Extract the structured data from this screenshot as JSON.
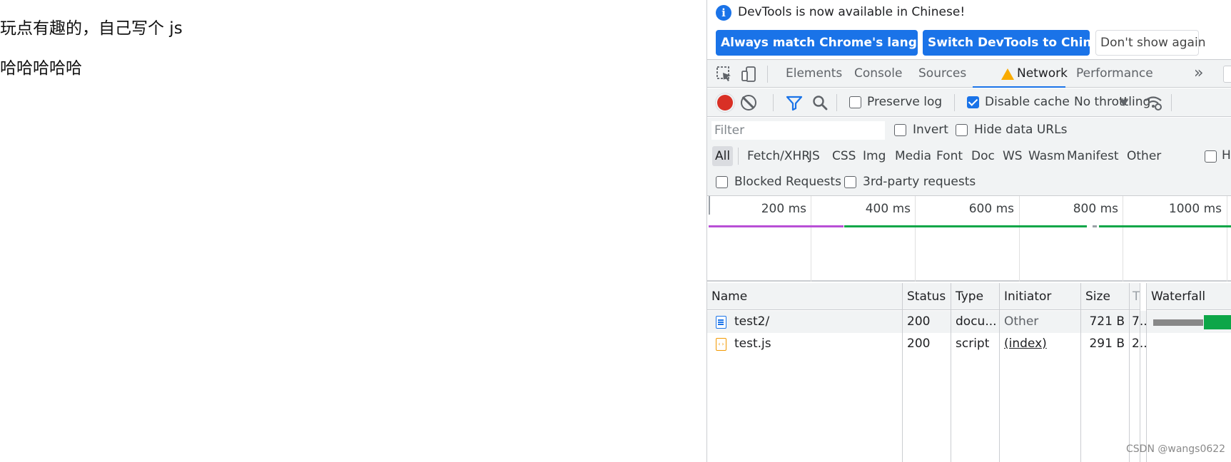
{
  "page": {
    "line1": "玩点有趣的，自己写个 js",
    "line2": "哈哈哈哈哈"
  },
  "infobar": {
    "message": "DevTools is now available in Chinese!",
    "buttons": {
      "match": "Always match Chrome's language",
      "switch": "Switch DevTools to Chinese",
      "dismiss": "Don't show again"
    }
  },
  "tabs": [
    {
      "label": "Elements"
    },
    {
      "label": "Console"
    },
    {
      "label": "Sources"
    },
    {
      "label": "Network",
      "active": true,
      "warning": true
    },
    {
      "label": "Performance"
    }
  ],
  "network_toolbar": {
    "preserve_log": {
      "label": "Preserve log",
      "checked": false
    },
    "disable_cache": {
      "label": "Disable cache",
      "checked": true
    },
    "throttling": "No throttling"
  },
  "filter": {
    "placeholder": "Filter",
    "invert": {
      "label": "Invert",
      "checked": false
    },
    "hide_data_urls": {
      "label": "Hide data URLs",
      "checked": false
    }
  },
  "type_filters": [
    "All",
    "Fetch/XHR",
    "JS",
    "CSS",
    "Img",
    "Media",
    "Font",
    "Doc",
    "WS",
    "Wasm",
    "Manifest",
    "Other"
  ],
  "type_filters_cut": "H",
  "blocked": {
    "blocked_requests": "Blocked Requests",
    "third_party": "3rd-party requests"
  },
  "overview": {
    "ticks": [
      "200 ms",
      "400 ms",
      "600 ms",
      "800 ms",
      "1000 ms"
    ]
  },
  "table": {
    "columns": [
      "Name",
      "Status",
      "Type",
      "Initiator",
      "Size",
      "T",
      "Waterfall"
    ],
    "rows": [
      {
        "name": "test2/",
        "status": "200",
        "type": "docu...",
        "initiator": "Other",
        "size": "721 B",
        "time": "7..",
        "icon": "document-icon"
      },
      {
        "name": "test.js",
        "status": "200",
        "type": "script",
        "initiator": "(index)",
        "size": "291 B",
        "time": "2..",
        "icon": "script-icon"
      }
    ]
  },
  "colors": {
    "accent": "#1a73e8",
    "record": "#d93025",
    "warning": "#f9ab00",
    "waterfall_green": "#0da648",
    "overview_purple": "#b84fd6"
  },
  "watermark": "CSDN @wangs0622"
}
